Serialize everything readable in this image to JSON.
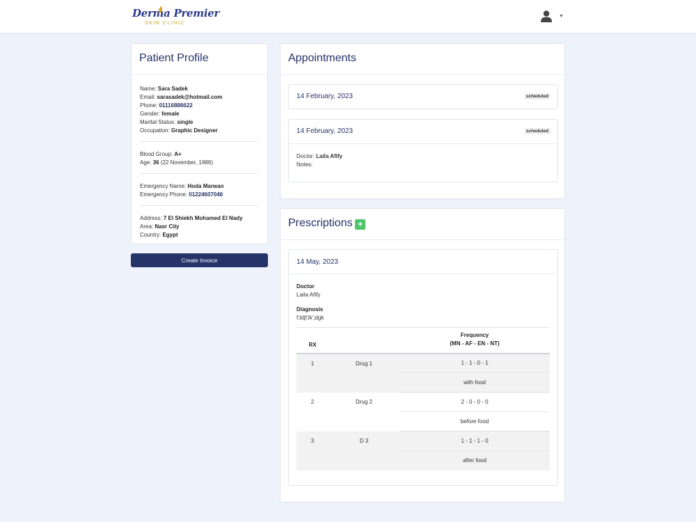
{
  "header": {
    "logo_script": "Derma Premier",
    "logo_sub": "SKIN CLINIC"
  },
  "profile": {
    "title": "Patient Profile",
    "name_label": "Name:",
    "name": "Sara Sadek",
    "email_label": "Email:",
    "email": "sarasadek@hotmail.com",
    "phone_label": "Phone:",
    "phone": "01116886622",
    "gender_label": "Gender:",
    "gender": "female",
    "marital_label": "Marital Status:",
    "marital": "single",
    "occupation_label": "Occupation:",
    "occupation": "Graphic Designer",
    "blood_label": "Blood Group:",
    "blood": "A+",
    "age_label": "Age:",
    "age": "36",
    "dob": "(22 November, 1986)",
    "em_name_label": "Emergency Name:",
    "em_name": "Hoda Marwan",
    "em_phone_label": "Emergency Phone:",
    "em_phone": "01224607046",
    "address_label": "Address:",
    "address": "7 El Shiekh Mohamed El Nady",
    "area_label": "Area:",
    "area": "Nasr City",
    "country_label": "Country:",
    "country": "Egypt",
    "invoice_button": "Create Invoice"
  },
  "appointments": {
    "title": "Appointments",
    "items": [
      {
        "date": "14 February, 2023",
        "status": "scheduled"
      },
      {
        "date": "14 February, 2023",
        "status": "scheduled",
        "doctor_label": "Doctor:",
        "doctor": "Laila Afify",
        "notes_label": "Notes:"
      }
    ]
  },
  "prescriptions": {
    "title": "Prescriptions",
    "add_label": "+",
    "date": "14 May, 2023",
    "doctor_label": "Doctor",
    "doctor": "Laila Afify",
    "diagnosis_label": "Diagnosis",
    "diagnosis": "f;ldjf;lk';dgk",
    "table": {
      "col_rx": "RX",
      "col_freq": "Frequency",
      "col_freq_sub": "(MN - AF - EN - NT)",
      "rows": [
        {
          "num": "1",
          "drug": "Drug 1",
          "freq": "1 - 1 - 0 - 1",
          "note": "with food"
        },
        {
          "num": "2",
          "drug": "Drug 2",
          "freq": "2 - 0 - 0 - 0",
          "note": "before food"
        },
        {
          "num": "3",
          "drug": "D 3",
          "freq": "1 - 1 - 1 - 0",
          "note": "after food"
        }
      ]
    }
  },
  "colors": {
    "primary": "#253368",
    "success": "#4cc46a",
    "background": "#eef3fb"
  },
  "icons": {
    "user": "user-avatar-icon",
    "caret": "caret-down-icon",
    "add": "plus-icon"
  }
}
